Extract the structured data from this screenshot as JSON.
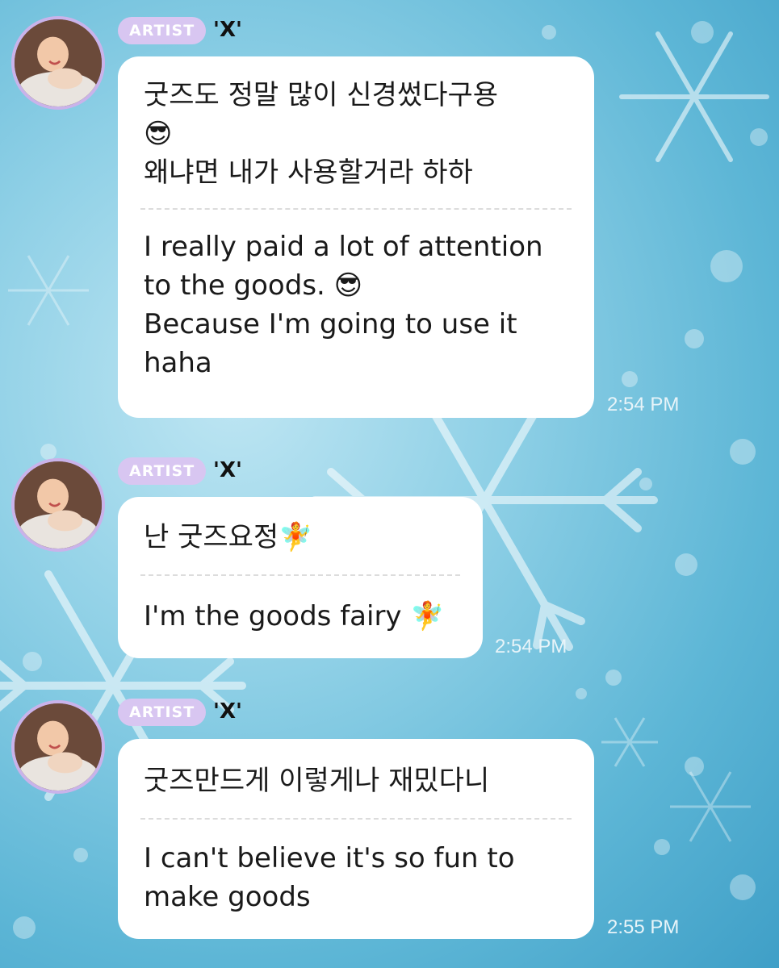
{
  "messages": [
    {
      "badge": "ARTIST",
      "name": "'X'",
      "korean": [
        "굿즈도 정말 많이 신경썼다구용",
        "😎",
        "왜냐면 내가 사용할거라 하하"
      ],
      "english": [
        "I really paid a lot of attention",
        "to the goods. 😎",
        "Because I'm going to use it",
        "haha"
      ],
      "time": "2:54 PM"
    },
    {
      "badge": "ARTIST",
      "name": "'X'",
      "korean": [
        "난 굿즈요정🧚"
      ],
      "english": [
        "I'm the goods fairy 🧚"
      ],
      "time": "2:54 PM"
    },
    {
      "badge": "ARTIST",
      "name": "'X'",
      "korean": [
        "굿즈만드게 이렇게나 재밌다니"
      ],
      "english": [
        "I can't believe it's so fun to",
        "make goods"
      ],
      "time": "2:55 PM"
    }
  ]
}
